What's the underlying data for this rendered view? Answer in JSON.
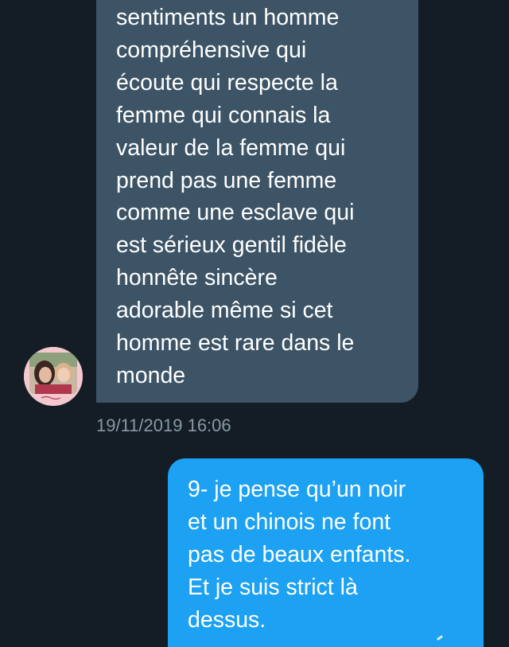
{
  "conversation": {
    "incoming_message": {
      "lines": [
        "sentiments un homme",
        "compréhensive qui",
        "écoute qui respecte la",
        "femme qui connais la",
        "valeur de la femme qui",
        "prend pas une femme",
        "comme une esclave qui",
        "est sérieux gentil fidèle",
        "honnête sincère",
        "adorable même si cet",
        "homme est rare dans le",
        "monde"
      ],
      "timestamp": "19/11/2019 16:06",
      "avatar": "user-avatar-photo"
    },
    "outgoing_message": {
      "lines": [
        "9- je pense qu’un noir",
        "et un chinois ne font",
        "pas de beaux enfants.",
        "Et je suis strict là",
        "dessus."
      ]
    }
  },
  "colors": {
    "background": "#141d26",
    "incoming_bubble": "#3d5466",
    "outgoing_bubble": "#1da1f2",
    "timestamp_text": "#8899a6",
    "message_text": "#ffffff"
  }
}
